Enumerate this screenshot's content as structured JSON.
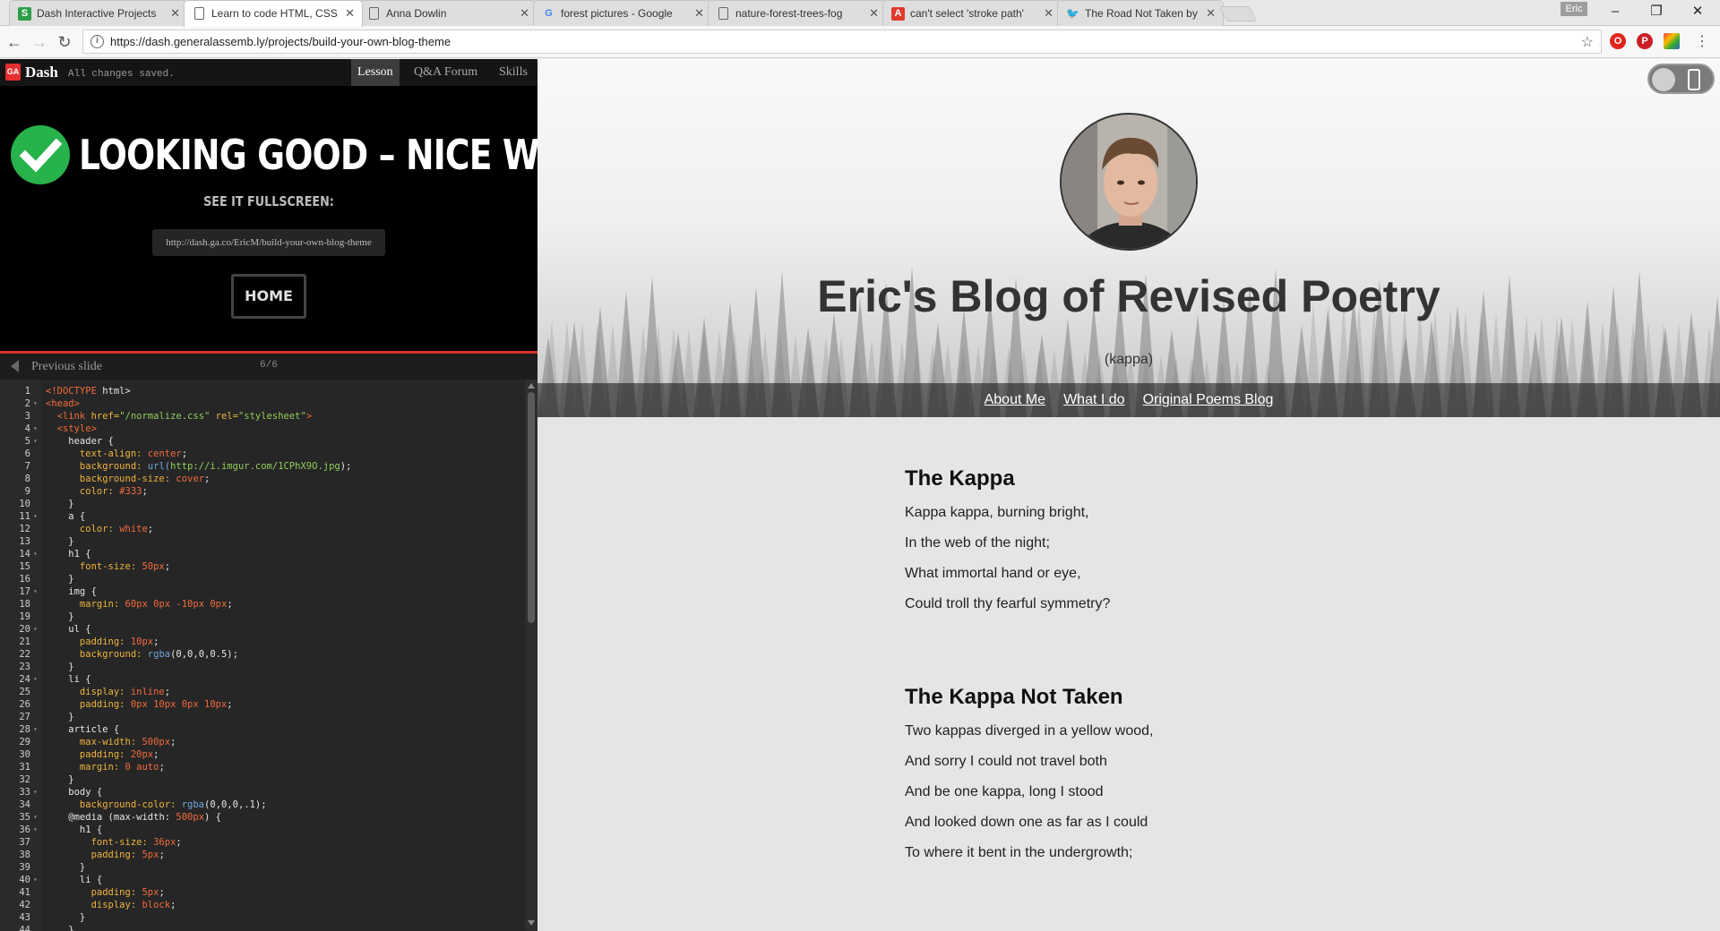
{
  "browser": {
    "tabs": [
      {
        "title": "Dash Interactive Projects",
        "favicon": "S",
        "favicon_color": "#2e9e47",
        "active": false
      },
      {
        "title": "Learn to code HTML, CSS",
        "favicon": "doc",
        "favicon_color": "#666666",
        "active": true
      },
      {
        "title": "Anna Dowlin",
        "favicon": "doc",
        "favicon_color": "#666666",
        "active": false
      },
      {
        "title": "forest pictures - Google",
        "favicon": "G",
        "favicon_color": "#4285f4",
        "active": false
      },
      {
        "title": "nature-forest-trees-fog",
        "favicon": "doc",
        "favicon_color": "#666666",
        "active": false
      },
      {
        "title": "can't select 'stroke path'",
        "favicon": "A",
        "favicon_color": "#e03a2b",
        "active": false
      },
      {
        "title": "The Road Not Taken by R",
        "favicon": "bird",
        "favicon_color": "#555555",
        "active": false
      }
    ],
    "user_badge": "Eric",
    "url": "https://dash.generalassemb.ly/projects/build-your-own-blog-theme",
    "colors": {
      "opera": "#e0251b",
      "pinterest": "#cb2027"
    }
  },
  "dash": {
    "logo": "GA",
    "name": "Dash",
    "status": "All changes saved.",
    "tabs": [
      "Lesson",
      "Q&A Forum",
      "Skills"
    ],
    "active_tab": "Lesson",
    "success_title": "LOOKING GOOD – NICE WORK!",
    "see_fullscreen": "SEE IT FULLSCREEN:",
    "fullscreen_url": "http://dash.ga.co/EricM/build-your-own-blog-theme",
    "home_label": "HOME",
    "prev_slide": "Previous slide",
    "slide_counter": "6/6",
    "accent": "#d9302a",
    "check_color": "#28b24b"
  },
  "code_lines": [
    {
      "n": "1",
      "fold": "",
      "tokens": [
        [
          "<!DOCTYPE ",
          "#f26b3a"
        ],
        [
          "html>",
          "#e6e6e6"
        ]
      ]
    },
    {
      "n": "2",
      "fold": "▾",
      "tokens": [
        [
          "<head>",
          "#f26b3a"
        ]
      ]
    },
    {
      "n": "3",
      "fold": "",
      "tokens": [
        [
          "  <link ",
          "#f26b3a"
        ],
        [
          "href=",
          "#f0b43c"
        ],
        [
          "\"/normalize.css\" ",
          "#8fcf5a"
        ],
        [
          "rel=",
          "#f0b43c"
        ],
        [
          "\"stylesheet\"",
          "#8fcf5a"
        ],
        [
          ">",
          "#f26b3a"
        ]
      ]
    },
    {
      "n": "4",
      "fold": "▾",
      "tokens": [
        [
          "  <style>",
          "#f26b3a"
        ]
      ]
    },
    {
      "n": "5",
      "fold": "▾",
      "tokens": [
        [
          "    header {",
          "#e6e6e6"
        ]
      ]
    },
    {
      "n": "6",
      "fold": "",
      "tokens": [
        [
          "      text-align: ",
          "#f0b43c"
        ],
        [
          "center",
          "#f26b3a"
        ],
        [
          ";",
          "#e6e6e6"
        ]
      ]
    },
    {
      "n": "7",
      "fold": "",
      "tokens": [
        [
          "      background: ",
          "#f0b43c"
        ],
        [
          "url(",
          "#6ea6e0"
        ],
        [
          "http://i.imgur.com/1CPhX9O.jpg",
          "#8fcf5a"
        ],
        [
          ");",
          "#e6e6e6"
        ]
      ]
    },
    {
      "n": "8",
      "fold": "",
      "tokens": [
        [
          "      background-size: ",
          "#f0b43c"
        ],
        [
          "cover",
          "#f26b3a"
        ],
        [
          ";",
          "#e6e6e6"
        ]
      ]
    },
    {
      "n": "9",
      "fold": "",
      "tokens": [
        [
          "      color: ",
          "#f0b43c"
        ],
        [
          "#333",
          "#f26b3a"
        ],
        [
          ";",
          "#e6e6e6"
        ]
      ]
    },
    {
      "n": "10",
      "fold": "",
      "tokens": [
        [
          "    }",
          "#e6e6e6"
        ]
      ]
    },
    {
      "n": "11",
      "fold": "▾",
      "tokens": [
        [
          "    a {",
          "#e6e6e6"
        ]
      ]
    },
    {
      "n": "12",
      "fold": "",
      "tokens": [
        [
          "      color: ",
          "#f0b43c"
        ],
        [
          "white",
          "#f26b3a"
        ],
        [
          ";",
          "#e6e6e6"
        ]
      ]
    },
    {
      "n": "13",
      "fold": "",
      "tokens": [
        [
          "    }",
          "#e6e6e6"
        ]
      ]
    },
    {
      "n": "14",
      "fold": "▾",
      "tokens": [
        [
          "    h1 {",
          "#e6e6e6"
        ]
      ]
    },
    {
      "n": "15",
      "fold": "",
      "tokens": [
        [
          "      font-size: ",
          "#f0b43c"
        ],
        [
          "50px",
          "#f26b3a"
        ],
        [
          ";",
          "#e6e6e6"
        ]
      ]
    },
    {
      "n": "16",
      "fold": "",
      "tokens": [
        [
          "    }",
          "#e6e6e6"
        ]
      ]
    },
    {
      "n": "17",
      "fold": "▾",
      "tokens": [
        [
          "    img {",
          "#e6e6e6"
        ]
      ]
    },
    {
      "n": "18",
      "fold": "",
      "tokens": [
        [
          "      margin: ",
          "#f0b43c"
        ],
        [
          "60px 0px -10px 0px",
          "#f26b3a"
        ],
        [
          ";",
          "#e6e6e6"
        ]
      ]
    },
    {
      "n": "19",
      "fold": "",
      "tokens": [
        [
          "    }",
          "#e6e6e6"
        ]
      ]
    },
    {
      "n": "20",
      "fold": "▾",
      "tokens": [
        [
          "    ul {",
          "#e6e6e6"
        ]
      ]
    },
    {
      "n": "21",
      "fold": "",
      "tokens": [
        [
          "      padding: ",
          "#f0b43c"
        ],
        [
          "10px",
          "#f26b3a"
        ],
        [
          ";",
          "#e6e6e6"
        ]
      ]
    },
    {
      "n": "22",
      "fold": "",
      "tokens": [
        [
          "      background: ",
          "#f0b43c"
        ],
        [
          "rgba",
          "#6ea6e0"
        ],
        [
          "(0,0,0,0.5);",
          "#e6e6e6"
        ]
      ]
    },
    {
      "n": "23",
      "fold": "",
      "tokens": [
        [
          "    }",
          "#e6e6e6"
        ]
      ]
    },
    {
      "n": "24",
      "fold": "▾",
      "tokens": [
        [
          "    li {",
          "#e6e6e6"
        ]
      ]
    },
    {
      "n": "25",
      "fold": "",
      "tokens": [
        [
          "      display: ",
          "#f0b43c"
        ],
        [
          "inline",
          "#f26b3a"
        ],
        [
          ";",
          "#e6e6e6"
        ]
      ]
    },
    {
      "n": "26",
      "fold": "",
      "tokens": [
        [
          "      padding: ",
          "#f0b43c"
        ],
        [
          "0px 10px 0px 10px",
          "#f26b3a"
        ],
        [
          ";",
          "#e6e6e6"
        ]
      ]
    },
    {
      "n": "27",
      "fold": "",
      "tokens": [
        [
          "    }",
          "#e6e6e6"
        ]
      ]
    },
    {
      "n": "28",
      "fold": "▾",
      "tokens": [
        [
          "    article {",
          "#e6e6e6"
        ]
      ]
    },
    {
      "n": "29",
      "fold": "",
      "tokens": [
        [
          "      max-width: ",
          "#f0b43c"
        ],
        [
          "500px",
          "#f26b3a"
        ],
        [
          ";",
          "#e6e6e6"
        ]
      ]
    },
    {
      "n": "30",
      "fold": "",
      "tokens": [
        [
          "      padding: ",
          "#f0b43c"
        ],
        [
          "20px",
          "#f26b3a"
        ],
        [
          ";",
          "#e6e6e6"
        ]
      ]
    },
    {
      "n": "31",
      "fold": "",
      "tokens": [
        [
          "      margin: ",
          "#f0b43c"
        ],
        [
          "0 auto",
          "#f26b3a"
        ],
        [
          ";",
          "#e6e6e6"
        ]
      ]
    },
    {
      "n": "32",
      "fold": "",
      "tokens": [
        [
          "    }",
          "#e6e6e6"
        ]
      ]
    },
    {
      "n": "33",
      "fold": "▾",
      "tokens": [
        [
          "    body {",
          "#e6e6e6"
        ]
      ]
    },
    {
      "n": "34",
      "fold": "",
      "tokens": [
        [
          "      background-color: ",
          "#f0b43c"
        ],
        [
          "rgba",
          "#6ea6e0"
        ],
        [
          "(0,0,0,.1);",
          "#e6e6e6"
        ]
      ]
    },
    {
      "n": "35",
      "fold": "▾",
      "tokens": [
        [
          "    @media ",
          "#e6e6e6"
        ],
        [
          "(max-width: ",
          "#e6e6e6"
        ],
        [
          "500px",
          "#f26b3a"
        ],
        [
          ") {",
          "#e6e6e6"
        ]
      ]
    },
    {
      "n": "36",
      "fold": "▾",
      "tokens": [
        [
          "      h1 {",
          "#e6e6e6"
        ]
      ]
    },
    {
      "n": "37",
      "fold": "",
      "tokens": [
        [
          "        font-size: ",
          "#f0b43c"
        ],
        [
          "36px",
          "#f26b3a"
        ],
        [
          ";",
          "#e6e6e6"
        ]
      ]
    },
    {
      "n": "38",
      "fold": "",
      "tokens": [
        [
          "        padding: ",
          "#f0b43c"
        ],
        [
          "5px",
          "#f26b3a"
        ],
        [
          ";",
          "#e6e6e6"
        ]
      ]
    },
    {
      "n": "39",
      "fold": "",
      "tokens": [
        [
          "      }",
          "#e6e6e6"
        ]
      ]
    },
    {
      "n": "40",
      "fold": "▾",
      "tokens": [
        [
          "      li {",
          "#e6e6e6"
        ]
      ]
    },
    {
      "n": "41",
      "fold": "",
      "tokens": [
        [
          "        padding: ",
          "#f0b43c"
        ],
        [
          "5px",
          "#f26b3a"
        ],
        [
          ";",
          "#e6e6e6"
        ]
      ]
    },
    {
      "n": "42",
      "fold": "",
      "tokens": [
        [
          "        display: ",
          "#f0b43c"
        ],
        [
          "block",
          "#f26b3a"
        ],
        [
          ";",
          "#e6e6e6"
        ]
      ]
    },
    {
      "n": "43",
      "fold": "",
      "tokens": [
        [
          "      }",
          "#e6e6e6"
        ]
      ]
    },
    {
      "n": "44",
      "fold": "",
      "tokens": [
        [
          "    }",
          "#e6e6e6"
        ]
      ]
    }
  ],
  "blog": {
    "title": "Eric's Blog of Revised Poetry",
    "subtitle": "(kappa)",
    "nav": [
      "About Me",
      "What I do",
      "Original Poems Blog"
    ],
    "articles": [
      {
        "heading": "The Kappa",
        "lines": [
          "Kappa kappa, burning bright,",
          "In the web of the night;",
          "What immortal hand or eye,",
          "Could troll thy fearful symmetry?"
        ]
      },
      {
        "heading": "The Kappa Not Taken",
        "lines": [
          "Two kappas diverged in a yellow wood,",
          "And sorry I could not travel both",
          "And be one kappa, long I stood",
          "And looked down one as far as I could",
          "To where it bent in the undergrowth;"
        ]
      }
    ]
  }
}
